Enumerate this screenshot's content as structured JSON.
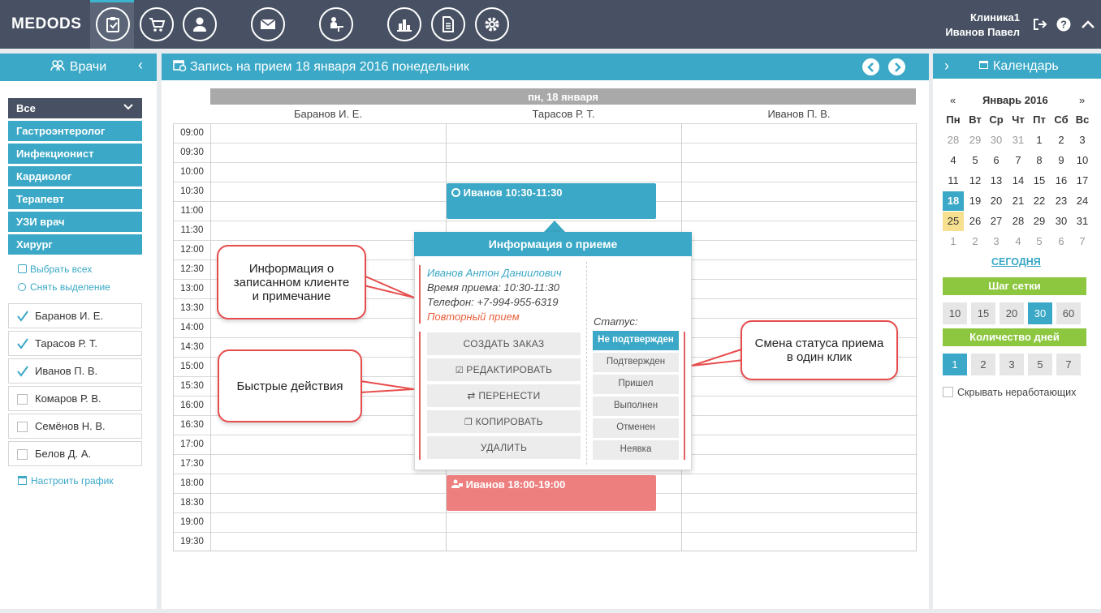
{
  "app": {
    "logo": "MEDODS"
  },
  "user": {
    "clinic": "Клиника1",
    "name": "Иванов Павел"
  },
  "nav_icons": [
    "clipboard-icon",
    "cart-icon",
    "user-icon",
    "mail-icon",
    "doctor-desk-icon",
    "bar-chart-icon",
    "document-icon",
    "gear-icon"
  ],
  "left": {
    "title": "Врачи",
    "filter_selected": "Все",
    "specialties": [
      "Гастроэнтеролог",
      "Инфекционист",
      "Кардиолог",
      "Терапевт",
      "УЗИ врач",
      "Хирург"
    ],
    "select_all": "Выбрать всех",
    "deselect": "Снять выделение",
    "doctors": [
      {
        "name": "Баранов И. Е.",
        "checked": true
      },
      {
        "name": "Тарасов Р. Т.",
        "checked": true
      },
      {
        "name": "Иванов П. В.",
        "checked": true
      },
      {
        "name": "Комаров Р. В.",
        "checked": false
      },
      {
        "name": "Семёнов Н. В.",
        "checked": false
      },
      {
        "name": "Белов Д. А.",
        "checked": false
      }
    ],
    "configure": "Настроить график"
  },
  "center": {
    "title": "Запись на прием 18 января 2016 понедельник",
    "day_header": "пн, 18 января",
    "columns": [
      "Баранов И. Е.",
      "Тарасов Р. Т.",
      "Иванов П. В."
    ],
    "times": [
      "09:00",
      "09:30",
      "10:00",
      "10:30",
      "11:00",
      "11:30",
      "12:00",
      "12:30",
      "13:00",
      "13:30",
      "14:00",
      "14:30",
      "15:00",
      "15:30",
      "16:00",
      "16:30",
      "17:00",
      "17:30",
      "18:00",
      "18:30",
      "19:00",
      "19:30"
    ],
    "appointment1": "Иванов 10:30-11:30",
    "appointment2": "Иванов 18:00-19:00"
  },
  "popup": {
    "title": "Информация о приеме",
    "patient": "Иванов Антон Даниилович",
    "time": "Время приема: 10:30-11:30",
    "phone": "Телефон: +7-994-955-6319",
    "note": "Повторный прием",
    "status_label": "Статус:",
    "actions": [
      "СОЗДАТЬ ЗАКАЗ",
      "РЕДАКТИРОВАТЬ",
      "ПЕРЕНЕСТИ",
      "КОПИРОВАТЬ",
      "УДАЛИТЬ"
    ],
    "statuses": [
      "Не подтвержден",
      "Подтвержден",
      "Пришел",
      "Выполнен",
      "Отменен",
      "Неявка"
    ]
  },
  "callouts": {
    "info": "Информация о записанном клиенте и примечание",
    "actions": "Быстрые действия",
    "status": "Смена статуса приема в один клик"
  },
  "right": {
    "title": "Календарь",
    "month": "Январь 2016",
    "weekdays": [
      "Пн",
      "Вт",
      "Ср",
      "Чт",
      "Пт",
      "Сб",
      "Вс"
    ],
    "weeks": [
      [
        "28",
        "29",
        "30",
        "31",
        "1",
        "2",
        "3"
      ],
      [
        "4",
        "5",
        "6",
        "7",
        "8",
        "9",
        "10"
      ],
      [
        "11",
        "12",
        "13",
        "14",
        "15",
        "16",
        "17"
      ],
      [
        "18",
        "19",
        "20",
        "21",
        "22",
        "23",
        "24"
      ],
      [
        "25",
        "26",
        "27",
        "28",
        "29",
        "30",
        "31"
      ],
      [
        "1",
        "2",
        "3",
        "4",
        "5",
        "6",
        "7"
      ]
    ],
    "today_link": "СЕГОДНЯ",
    "grid_step_label": "Шаг сетки",
    "grid_steps": [
      "10",
      "15",
      "20",
      "30",
      "60"
    ],
    "grid_step_selected": "30",
    "days_label": "Количество дней",
    "days": [
      "1",
      "2",
      "3",
      "5",
      "7"
    ],
    "days_selected": "1",
    "hide_nonworking": "Скрывать неработающих"
  },
  "colors": {
    "accent": "#3aa8c6",
    "topbar": "#475163",
    "green": "#8dc63f",
    "appt_red": "#ee7f7f",
    "callout_border": "#e74c4c"
  }
}
